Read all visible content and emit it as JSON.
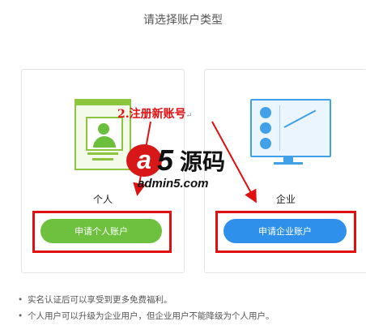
{
  "page_title": "请选择账户类型",
  "personal": {
    "label": "个人",
    "button_label": "申请个人账户"
  },
  "enterprise": {
    "label": "企业",
    "button_label": "申请企业账户"
  },
  "annotation": {
    "text": "2.注册新账号",
    "mark": "↵"
  },
  "watermark": {
    "brand": "a5源码",
    "url": "admin5.com"
  },
  "notes": [
    "实名认证后可以享受到更多免费福利。",
    "个人用户可以升级为企业用户，但企业用户不能降级为个人用户。"
  ],
  "colors": {
    "personal_accent": "#6ec13f",
    "enterprise_accent": "#2e90ea",
    "highlight_red": "#e01010"
  }
}
